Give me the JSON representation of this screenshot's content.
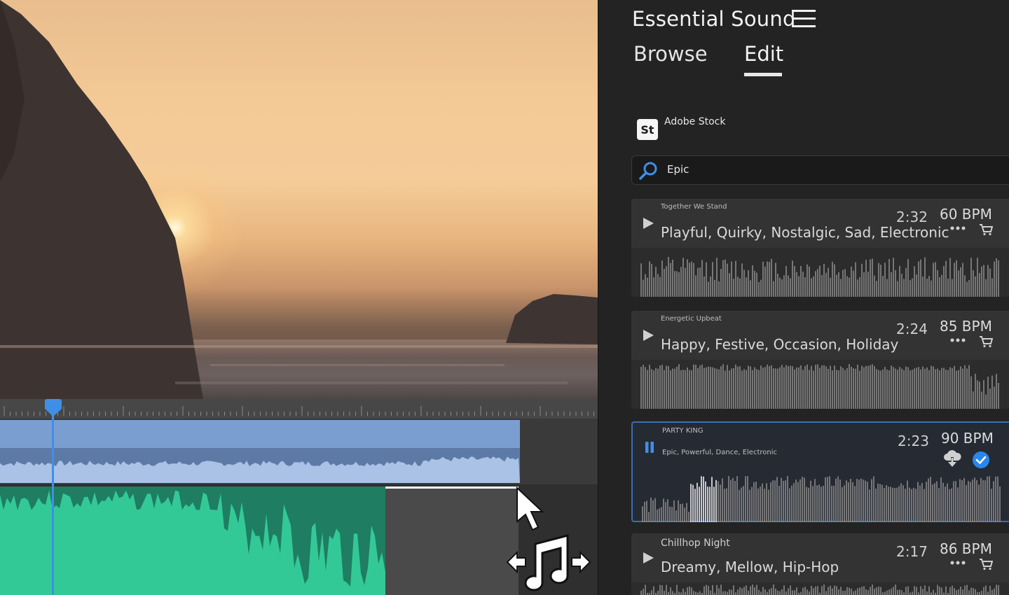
{
  "panel": {
    "title": "Essential Sound",
    "tabs": [
      {
        "label": "Browse",
        "active": false
      },
      {
        "label": "Edit",
        "active": true
      }
    ],
    "source_label": "Adobe Stock",
    "source_logo_text": "St",
    "search": {
      "value": "Epic"
    }
  },
  "tracks": [
    {
      "title": "Together We Stand",
      "tags": "Playful, Quirky, Nostalgic, Sad, Electronic",
      "duration": "2:32",
      "bpm": "60 BPM",
      "state": "stopped"
    },
    {
      "title": "Energetic Upbeat",
      "tags": "Happy, Festive, Occasion, Holiday",
      "duration": "2:24",
      "bpm": "85 BPM",
      "state": "stopped"
    },
    {
      "title": "PARTY KING",
      "tags": "Epic, Powerful, Dance, Electronic",
      "duration": "2:23",
      "bpm": "90 BPM",
      "state": "playing"
    },
    {
      "title": "Chillhop Night",
      "tags": "Dreamy, Mellow, Hip-Hop",
      "duration": "2:17",
      "bpm": "86 BPM",
      "state": "stopped"
    }
  ],
  "icons": {
    "menu": "hamburger-icon",
    "search": "magnifier-icon",
    "play": "play-icon",
    "pause": "pause-icon",
    "more": "ellipsis-icon",
    "cart": "cart-icon",
    "cloud": "cloud-download-icon",
    "check": "check-circle-icon",
    "cursor": "move-music-cursor-icon"
  },
  "colors": {
    "accent": "#3f8fe6",
    "audio_clip": "#1f7d62",
    "audio_wave": "#33c997",
    "video_clip": "#7b9ed0",
    "panel_bg": "#232323"
  }
}
